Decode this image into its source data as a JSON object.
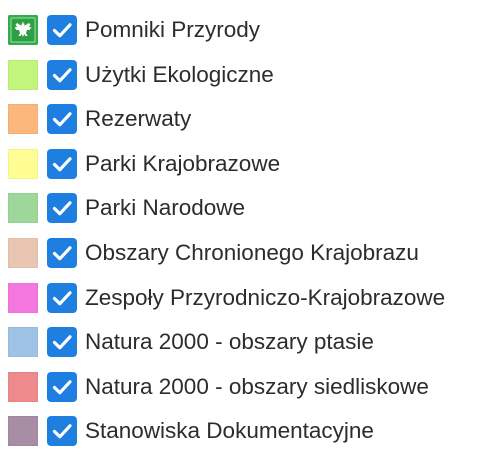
{
  "legend": {
    "items": [
      {
        "key": "pomniki",
        "label": "Pomniki Przyrody",
        "swatch_color": "#33ad4a",
        "swatch_icon": "eagle-emblem-icon",
        "checked": true
      },
      {
        "key": "uzytki",
        "label": "Użytki Ekologiczne",
        "swatch_color": "#c2f57b",
        "checked": true
      },
      {
        "key": "rezerwaty",
        "label": "Rezerwaty",
        "swatch_color": "#fbb77c",
        "checked": true
      },
      {
        "key": "parki-krajobrazowe",
        "label": "Parki Krajobrazowe",
        "swatch_color": "#fefe95",
        "checked": true
      },
      {
        "key": "parki-narodowe",
        "label": "Parki Narodowe",
        "swatch_color": "#9dd79a",
        "checked": true
      },
      {
        "key": "obszary-chronionego",
        "label": "Obszary Chronionego Krajobrazu",
        "swatch_color": "#e9c6b2",
        "checked": true
      },
      {
        "key": "zespoly",
        "label": "Zespoły Przyrodniczo-Krajobrazowe",
        "swatch_color": "#f477e0",
        "checked": true
      },
      {
        "key": "natura-ptasie",
        "label": "Natura 2000 - obszary ptasie",
        "swatch_color": "#9fc3e6",
        "checked": true
      },
      {
        "key": "natura-siedliskowe",
        "label": "Natura 2000 - obszary siedliskowe",
        "swatch_color": "#ee8a8b",
        "checked": true
      },
      {
        "key": "stanowiska",
        "label": "Stanowiska Dokumentacyjne",
        "swatch_color": "#a88da4",
        "checked": true
      }
    ]
  },
  "colors": {
    "checkbox_fill": "#1f7fe0",
    "checkmark": "#ffffff",
    "text": "#2c2c2c"
  }
}
